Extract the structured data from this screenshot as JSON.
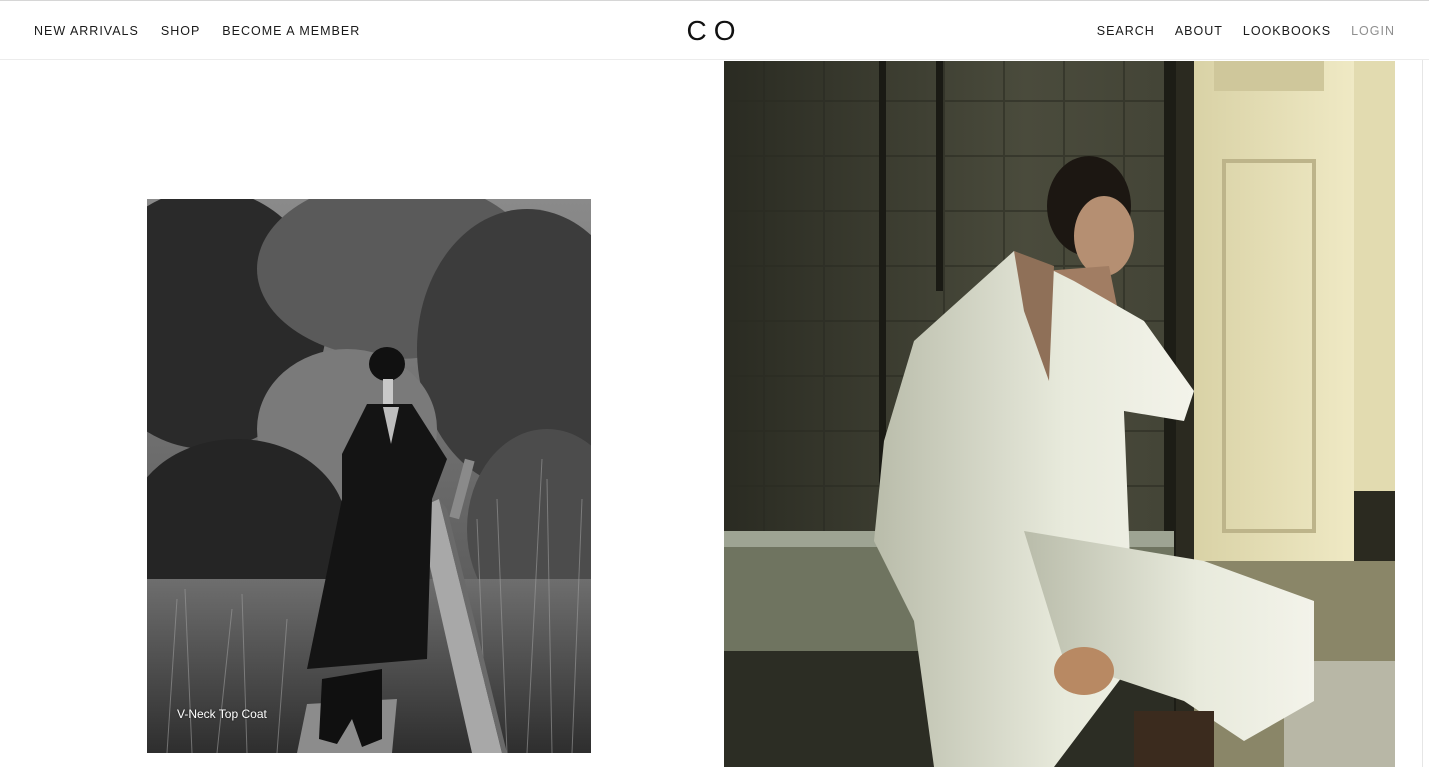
{
  "header": {
    "logo": "CO",
    "nav_left": [
      "NEW ARRIVALS",
      "SHOP",
      "BECOME A MEMBER"
    ],
    "nav_right": [
      "SEARCH",
      "ABOUT",
      "LOOKBOOKS",
      "LOGIN"
    ]
  },
  "products": [
    {
      "caption": "V-Neck Top Coat"
    }
  ]
}
